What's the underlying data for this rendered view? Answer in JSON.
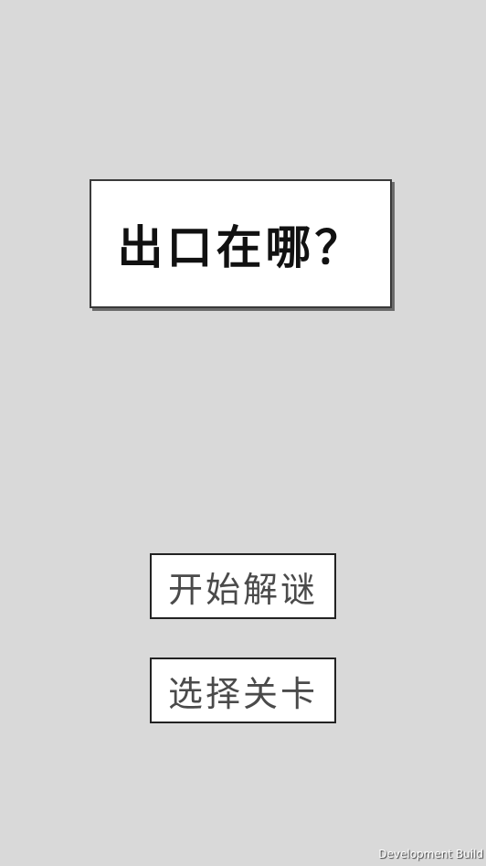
{
  "title": "出口在哪？",
  "menu": {
    "start_label": "开始解谜",
    "levels_label": "选择关卡"
  },
  "footer": {
    "build_label": "Development Build"
  },
  "colors": {
    "background": "#d9d9d9",
    "panel": "#ffffff",
    "border": "#222222",
    "title_text": "#111111",
    "button_text": "#4a4a4a"
  }
}
